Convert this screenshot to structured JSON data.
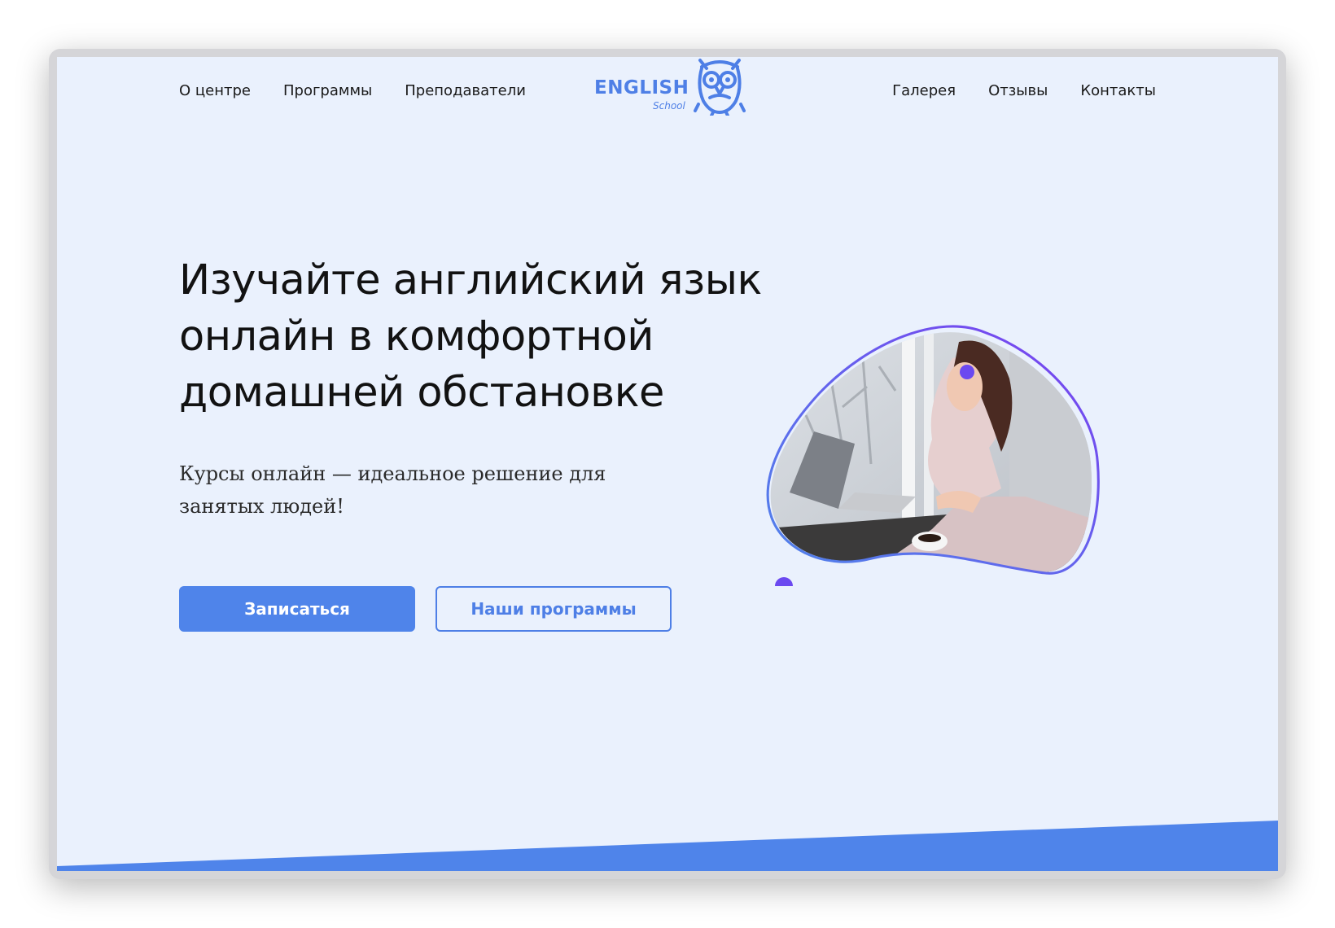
{
  "nav": {
    "left": [
      "О центре",
      "Программы",
      "Преподаватели"
    ],
    "right": [
      "Галерея",
      "Отзывы",
      "Контакты"
    ]
  },
  "logo": {
    "word": "ENGLISH",
    "sub": "School",
    "icon": "owl-icon"
  },
  "hero": {
    "headline": "Изучайте английский язык онлайн в комфортной домашней обстановке",
    "subtitle": "Курсы онлайн — идеальное решение для занятых людей!",
    "primary_button": "Записаться",
    "secondary_button": "Наши программы",
    "image": "woman-at-laptop-photo"
  },
  "colors": {
    "accent": "#4f84ea",
    "background": "#eaf1fd",
    "outline_gradient_start": "#4f84ea",
    "outline_gradient_end": "#7b3ff0",
    "dots": "#6b49f0"
  }
}
